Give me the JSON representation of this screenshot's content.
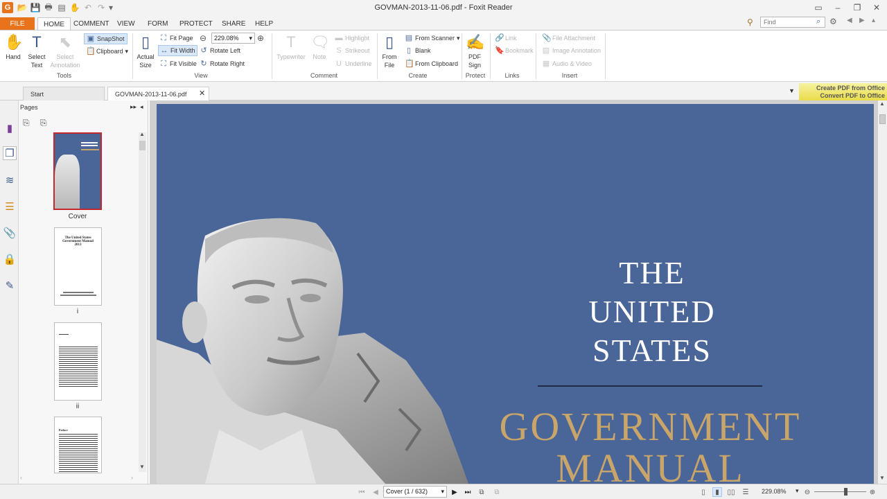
{
  "window": {
    "title": "GOVMAN-2013-11-06.pdf - Foxit Reader"
  },
  "menu": {
    "file": "FILE",
    "home": "HOME",
    "comment": "COMMENT",
    "view": "VIEW",
    "form": "FORM",
    "protect": "PROTECT",
    "share": "SHARE",
    "help": "HELP"
  },
  "search": {
    "placeholder": "Find"
  },
  "ribbon": {
    "tools": {
      "hand": "Hand",
      "select_text": "Select\nText",
      "select_annotation": "Select\nAnnotation",
      "snapshot": "SnapShot",
      "clipboard": "Clipboard",
      "label": "Tools"
    },
    "view": {
      "actual_size": "Actual\nSize",
      "fit_page": "Fit Page",
      "fit_width": "Fit Width",
      "fit_visible": "Fit Visible",
      "zoom": "229.08%",
      "rotate_left": "Rotate Left",
      "rotate_right": "Rotate Right",
      "label": "View"
    },
    "comment": {
      "typewriter": "Typewriter",
      "note": "Note",
      "highlight": "Highlight",
      "strikeout": "Strikeout",
      "underline": "Underline",
      "label": "Comment"
    },
    "create": {
      "from_file": "From\nFile",
      "from_scanner": "From Scanner",
      "blank": "Blank",
      "from_clipboard": "From Clipboard",
      "label": "Create"
    },
    "protect": {
      "pdf_sign": "PDF\nSign",
      "label": "Protect"
    },
    "links": {
      "link": "Link",
      "bookmark": "Bookmark",
      "label": "Links"
    },
    "insert": {
      "file_attachment": "File Attachment",
      "image_annotation": "Image Annotation",
      "audio_video": "Audio & Video",
      "label": "Insert"
    }
  },
  "tabs": {
    "start": "Start",
    "document": "GOVMAN-2013-11-06.pdf"
  },
  "promo": {
    "line1": "Create PDF from Office",
    "line2": "Convert PDF to Office"
  },
  "pages_panel": {
    "title": "Pages",
    "thumbs": [
      {
        "caption": "Cover"
      },
      {
        "caption": "i",
        "text1": "The United States",
        "text2": "Government Manual",
        "text3": "2013"
      },
      {
        "caption": "ii"
      },
      {
        "caption": "",
        "text1": "Preface"
      }
    ]
  },
  "document": {
    "line1": "THE",
    "line2": "UNITED",
    "line3": "STATES",
    "line4": "GOVERNMENT",
    "line5": "MANUAL"
  },
  "status": {
    "page": "Cover (1 / 632)",
    "zoom": "229.08%"
  },
  "colors": {
    "accent": "#e8731a",
    "page_blue": "#4a6597",
    "gold": "#c9a56a"
  }
}
